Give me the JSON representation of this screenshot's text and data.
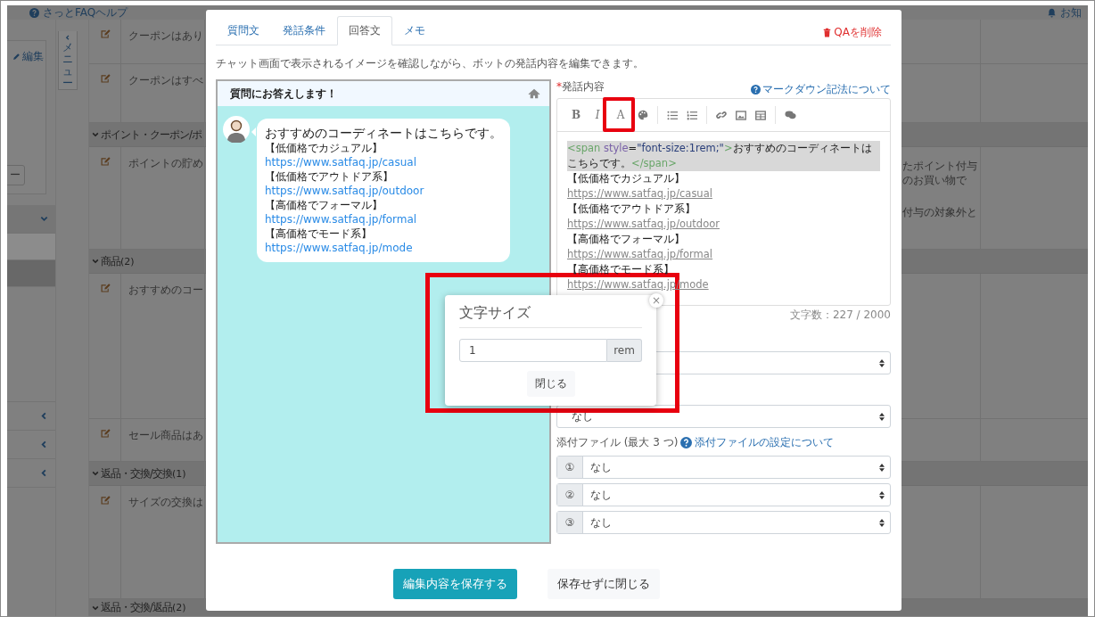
{
  "background": {
    "top_bar": {
      "help_link": "さっとFAQヘルプ",
      "notice_link": "お知"
    },
    "sidebar": {
      "edit_link": "編集",
      "panel_button": "ー",
      "sections": [
        {
          "expanded": true,
          "items": [
            {
              "selected": false
            },
            {
              "selected": true
            }
          ]
        },
        {
          "expanded": false
        },
        {
          "expanded": false
        },
        {
          "expanded": false
        }
      ]
    },
    "menu_tab": {
      "label": "メニュー"
    },
    "table": {
      "rows": [
        {
          "kind": "row",
          "text": "クーポンはあり"
        },
        {
          "kind": "row",
          "text": "クーポンはすべ"
        },
        {
          "kind": "group",
          "label": "ポイント・クーポン/ポ",
          "expanded": true
        },
        {
          "kind": "row",
          "text": "ポイントの貯め",
          "right_paragraphs": [
            [
              "たポイント付与",
              "のお買い物で"
            ],
            [
              "付与の対象外と"
            ]
          ]
        },
        {
          "kind": "group",
          "label": "商品",
          "count": "(2)",
          "expanded": true
        },
        {
          "kind": "row",
          "text": "おすすめのコー"
        },
        {
          "kind": "row",
          "text": "セール商品はあ"
        },
        {
          "kind": "group",
          "label": "返品・交換/交換",
          "count": "(1)",
          "expanded": true
        },
        {
          "kind": "row",
          "text": "サイズの交換は"
        },
        {
          "kind": "group",
          "label": "返品・交換/返品",
          "count": "(2)",
          "expanded": true
        }
      ]
    }
  },
  "modal": {
    "tabs": [
      {
        "label": "質問文",
        "selected": false
      },
      {
        "label": "発話条件",
        "selected": false
      },
      {
        "label": "回答文",
        "selected": true
      },
      {
        "label": "メモ",
        "selected": false
      }
    ],
    "delete_link": "QAを削除",
    "description": "チャット画面で表示されるイメージを確認しながら、ボットの発話内容を編集できます。",
    "preview": {
      "title": "質問にお答えします！",
      "lead": "おすすめのコーディネートはこちらです。",
      "lines": [
        {
          "kind": "text",
          "text": "【低価格でカジュアル】"
        },
        {
          "kind": "link",
          "text": "https://www.satfaq.jp/casual"
        },
        {
          "kind": "text",
          "text": "【低価格でアウトドア系】"
        },
        {
          "kind": "link",
          "text": "https://www.satfaq.jp/outdoor"
        },
        {
          "kind": "text",
          "text": "【高価格でフォーマル】"
        },
        {
          "kind": "link",
          "text": "https://www.satfaq.jp/formal"
        },
        {
          "kind": "text",
          "text": "【高価格でモード系】"
        },
        {
          "kind": "link",
          "text": "https://www.satfaq.jp/mode"
        }
      ]
    },
    "editor": {
      "label": "発話内容",
      "required_mark": "*",
      "help_link": "マークダウン記法について",
      "toolbar": [
        {
          "label": "B",
          "highlighted": false
        },
        {
          "label": "I",
          "highlighted": false
        },
        {
          "label": "A",
          "highlighted": true
        }
      ],
      "code": [
        {
          "kind": "tag",
          "text": "<span"
        },
        {
          "kind": "attr",
          "text": " style"
        },
        {
          "kind": "plain",
          "text": "="
        },
        {
          "kind": "string",
          "text": "\"font-size:1rem;\""
        },
        {
          "kind": "tag",
          "text": ">"
        },
        {
          "kind": "plain",
          "text": "おすすめのコーディネートはこちらです。"
        },
        {
          "kind": "tag",
          "text": "</span>"
        }
      ],
      "lines": [
        {
          "kind": "text",
          "text": "【低価格でカジュアル】"
        },
        {
          "kind": "link",
          "text": "https://www.satfaq.jp/casual"
        },
        {
          "kind": "text",
          "text": "【低価格でアウトドア系】"
        },
        {
          "kind": "link",
          "text": "https://www.satfaq.jp/outdoor"
        },
        {
          "kind": "text",
          "text": "【高価格でフォーマル】"
        },
        {
          "kind": "link",
          "text": "https://www.satfaq.jp/formal"
        },
        {
          "kind": "text",
          "text": "【高価格でモード系】"
        },
        {
          "kind": "link",
          "text": "https://www.satfaq.jp/mode"
        }
      ],
      "count": "文字数：227 / 2000"
    },
    "fields": [
      {
        "kind": "select"
      },
      {
        "kind": "select",
        "value": "なし"
      }
    ],
    "attachments": {
      "label": "添付ファイル (最大 3 つ)",
      "help_link": "添付ファイルの設定について",
      "rows": [
        {
          "index": "①",
          "value": "なし"
        },
        {
          "index": "②",
          "value": "なし"
        },
        {
          "index": "③",
          "value": "なし"
        }
      ]
    },
    "save_button": "編集内容を保存する",
    "cancel_button": "保存せずに閉じる",
    "popover": {
      "title": "文字サイズ",
      "value": "1",
      "unit": "rem",
      "close_button": "閉じる",
      "close_glyph": "×",
      "highlighted": true
    }
  }
}
